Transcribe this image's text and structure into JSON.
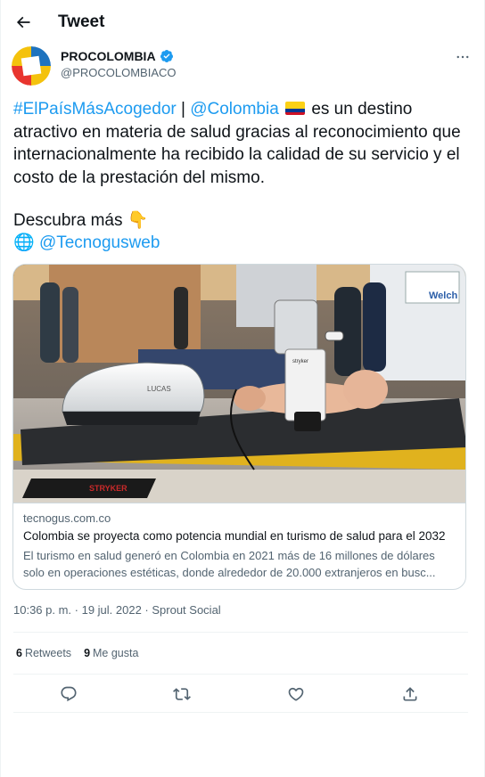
{
  "header": {
    "title": "Tweet"
  },
  "author": {
    "name": "PROCOLOMBIA",
    "handle": "@PROCOLOMBIACO",
    "verified": true
  },
  "tweet": {
    "hashtag": "#ElPaísMásAcogedor",
    "separator": " | ",
    "mention": "@Colombia",
    "body": " es un destino atractivo en materia de salud gracias al reconocimiento que internacionalmente ha recibido la calidad de su servicio y el costo de la prestación del mismo.",
    "cta": "Descubra más ",
    "cta_emoji": "👇",
    "globe_emoji": "🌐",
    "source_mention": "@Tecnogusweb"
  },
  "card": {
    "domain": "tecnogus.com.co",
    "title": "Colombia se proyecta como potencia mundial en turismo de salud para el 2032",
    "desc_line1": "El turismo en salud generó en Colombia en 2021 más de 16 millones de dólares",
    "desc_line2": "solo en operaciones estéticas, donde alrededor de 20.000 extranjeros en busc...",
    "image_texts": {
      "device_label": "LUCAS",
      "sign": "Welch",
      "brand": "stryker"
    }
  },
  "meta": {
    "timestamp": "10:36 p. m. · 19 jul. 2022 · Sprout Social"
  },
  "stats": {
    "retweets_count": "6",
    "retweets_label": "Retweets",
    "likes_count": "9",
    "likes_label": "Me gusta"
  },
  "icons": {
    "back": "arrow-left-icon",
    "verified": "verified-badge-icon",
    "more": "more-horizontal-icon",
    "reply": "reply-icon",
    "retweet": "retweet-icon",
    "like": "heart-icon",
    "share": "share-icon"
  },
  "colors": {
    "link": "#1d9bf0",
    "secondary_text": "#536471",
    "border": "#cfd9de"
  }
}
